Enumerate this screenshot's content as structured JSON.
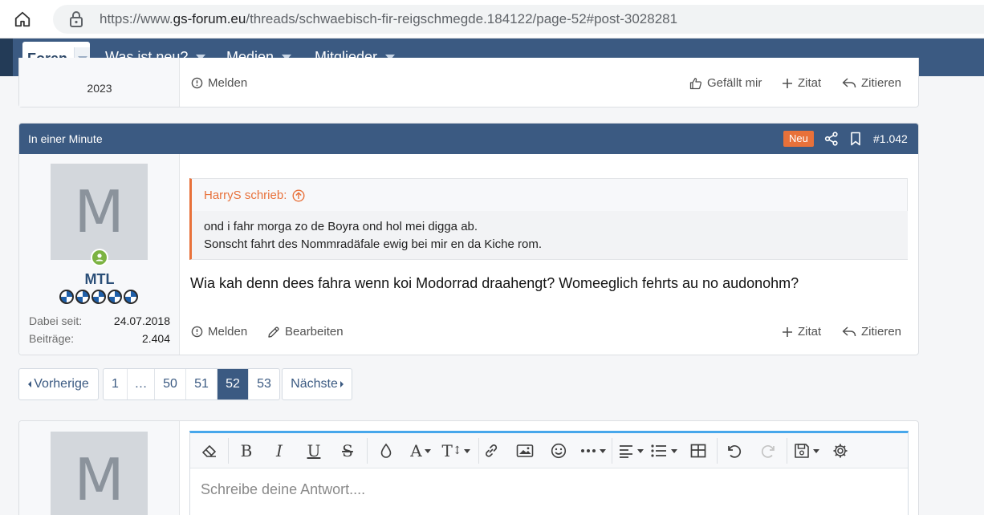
{
  "browser": {
    "url_prefix": "https://www.",
    "url_domain": "gs-forum.eu",
    "url_path": "/threads/schwaebisch-fir-reigschmegde.184122/page-52#post-3028281"
  },
  "nav": {
    "items": [
      {
        "label": "Foren"
      },
      {
        "label": "Was ist neu?"
      },
      {
        "label": "Medien"
      },
      {
        "label": "Mitglieder"
      }
    ]
  },
  "prev_post": {
    "year": "2023",
    "report": "Melden",
    "like": "Gefällt mir",
    "quote": "Zitat",
    "reply": "Zitieren"
  },
  "post": {
    "time": "In einer Minute",
    "badge": "Neu",
    "number": "#1.042",
    "user": {
      "avatar_letter": "M",
      "name": "MTL",
      "joined_label": "Dabei seit:",
      "joined_value": "24.07.2018",
      "posts_label": "Beiträge:",
      "posts_value": "2.404"
    },
    "quote": {
      "author": "HarryS schrieb:",
      "line1": "ond i fahr morga zo de Boyra ond hol mei digga ab.",
      "line2": "Sonscht fahrt des Nommradäfale ewig bei mir en da Kiche rom."
    },
    "message": "Wia kah denn dees fahra wenn koi Modorrad draahengt? Womeeglich fehrts au no audonohm?",
    "actions": {
      "report": "Melden",
      "edit": "Bearbeiten",
      "quote": "Zitat",
      "reply": "Zitieren"
    }
  },
  "pagination": {
    "prev": "Vorherige",
    "next": "Nächste",
    "pages": [
      "1",
      "…",
      "50",
      "51",
      "52",
      "53"
    ],
    "current": "52"
  },
  "reply": {
    "avatar_letter": "M",
    "placeholder": "Schreibe deine Antwort...."
  },
  "colors": {
    "nav": "#3b5a82",
    "accent": "#e8713a",
    "editor_top": "#47a7eb"
  }
}
